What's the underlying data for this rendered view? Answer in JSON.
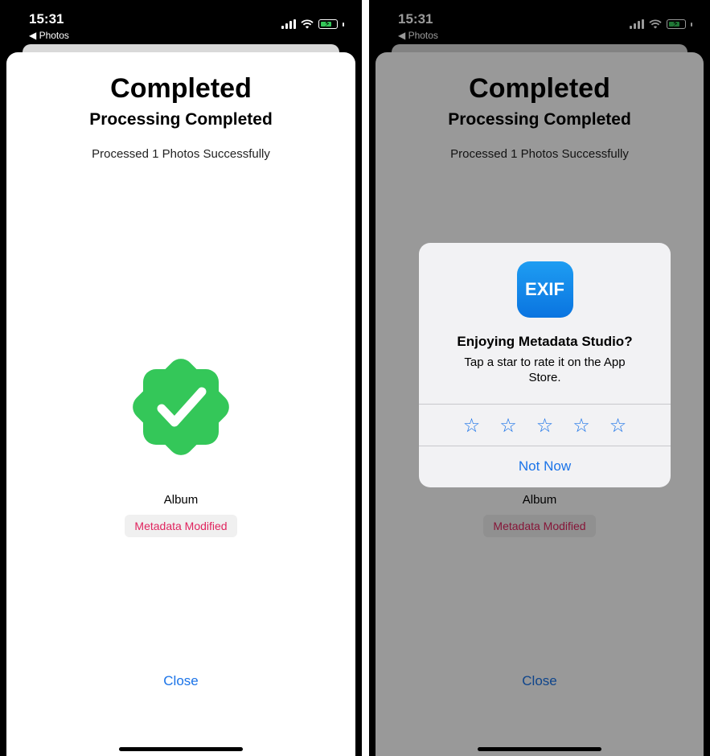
{
  "status_bar": {
    "time": "15:31",
    "back_label": "◀ Photos"
  },
  "screen": {
    "title": "Completed",
    "subtitle": "Processing Completed",
    "summary": "Processed 1 Photos Successfully",
    "badge_icon": "checkmark-seal-icon",
    "album_label": "Album",
    "chip_label": "Metadata Modified",
    "close_label": "Close"
  },
  "rating_alert": {
    "app_icon_text": "EXIF",
    "title": "Enjoying Metadata Studio?",
    "message": "Tap a star to rate it on the App Store.",
    "stars": [
      "☆",
      "☆",
      "☆",
      "☆",
      "☆"
    ],
    "dismiss_label": "Not Now"
  },
  "colors": {
    "accent_blue": "#1a73e8",
    "success_green": "#34c759",
    "chip_text": "#e0245e"
  }
}
